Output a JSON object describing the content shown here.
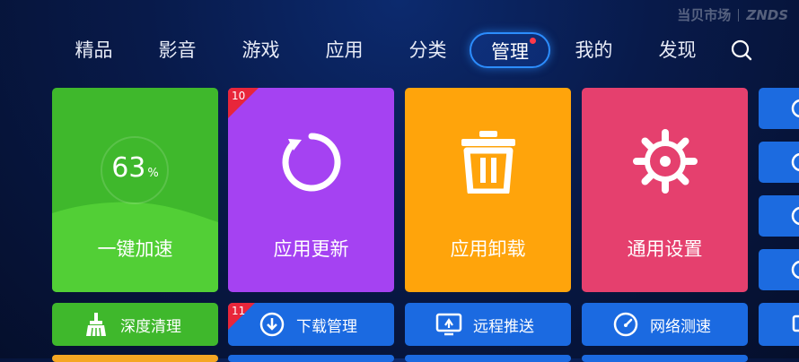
{
  "watermark": {
    "brand_cn": "当贝市场",
    "brand_en": "ZNDS"
  },
  "nav": {
    "items": [
      "精品",
      "影音",
      "游戏",
      "应用",
      "分类",
      "管理",
      "我的",
      "发现"
    ],
    "active_index": 5
  },
  "tiles": {
    "speed": {
      "label": "一键加速",
      "value": "63",
      "unit": "%",
      "color": "#3fbf2e"
    },
    "update": {
      "label": "应用更新",
      "badge": "10",
      "color": "#a542f2"
    },
    "uninstall": {
      "label": "应用卸载",
      "color": "#ffa40b"
    },
    "settings": {
      "label": "通用设置",
      "color": "#e5406e"
    }
  },
  "small_tiles": {
    "clean": {
      "label": "深度清理",
      "color": "#3fb82c"
    },
    "download": {
      "label": "下载管理",
      "badge": "11",
      "color": "#1b6ae1"
    },
    "remote": {
      "label": "远程推送",
      "color": "#1b6ae1"
    },
    "network": {
      "label": "网络测速",
      "color": "#1b6ae1"
    }
  },
  "colors": {
    "accent": "#2c8dff",
    "side_tile": "#1c6be0"
  }
}
